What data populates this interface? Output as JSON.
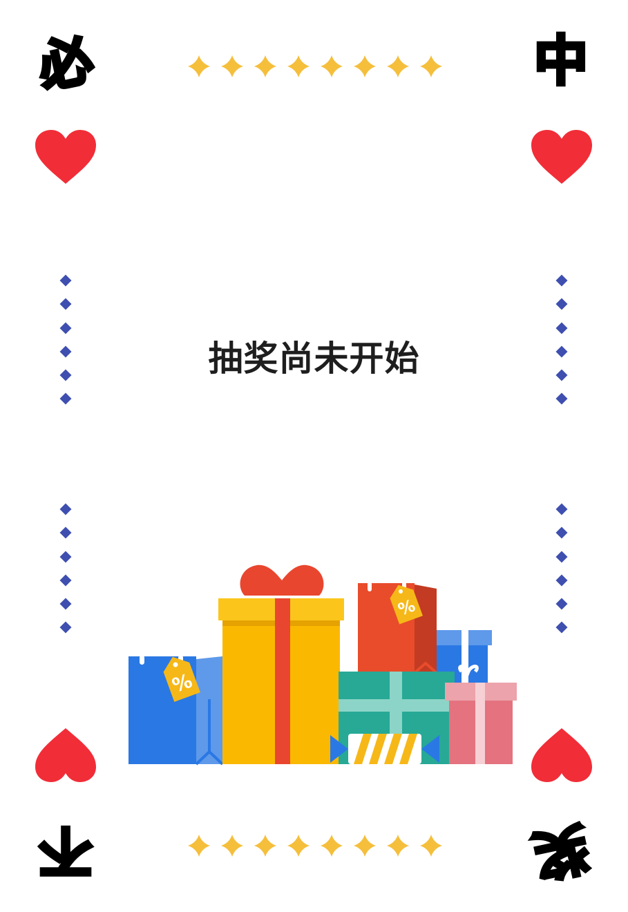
{
  "corners": {
    "top_left": "必",
    "top_right": "中",
    "bottom_left": "不",
    "bottom_right": "奖"
  },
  "message": "抽奖尚未开始",
  "tags": {
    "discount_symbol": "%"
  },
  "colors": {
    "heart": "#f12d38",
    "star": "#f5bf3c",
    "dot": "#3e4fb0",
    "text": "#1e1e1e"
  },
  "icons": [
    "heart-icon",
    "star-icon",
    "diamond-dot-icon",
    "gift-boxes-illustration"
  ]
}
